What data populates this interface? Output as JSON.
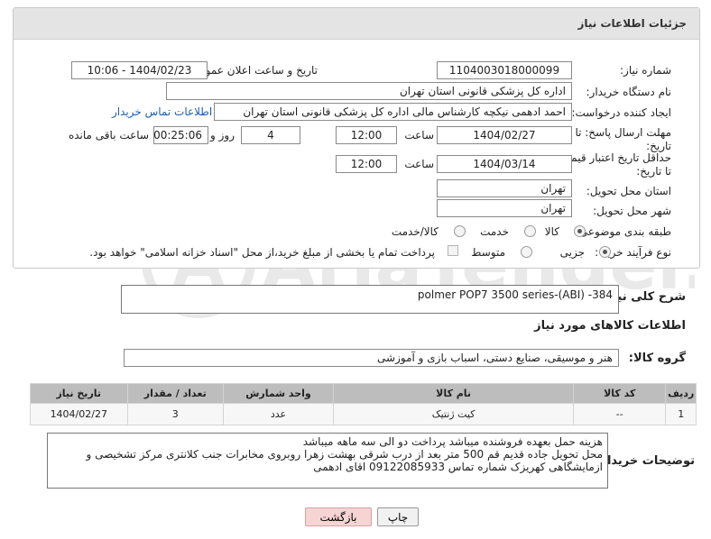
{
  "header": {
    "title": "جزئیات اطلاعات نیاز"
  },
  "fields": {
    "need_number_label": "شماره نیاز:",
    "need_number": "1104003018000099",
    "announce_label": "تاریخ و ساعت اعلان عمومی:",
    "announce_value": "1404/02/23 - 10:06",
    "buyer_org_label": "نام دستگاه خریدار:",
    "buyer_org": "اداره کل پزشکی قانونی استان تهران",
    "creator_label": "ایجاد کننده درخواست:",
    "creator": "احمد ادهمی نیکچه کارشناس مالی اداره کل پزشکی قانونی استان تهران",
    "contact_link": "اطلاعات تماس خریدار",
    "deadline_label_1": "مهلت ارسال پاسخ: تا",
    "deadline_label_2": "تاریخ:",
    "deadline_date": "1404/02/27",
    "time_label": "ساعت",
    "deadline_time": "12:00",
    "days_value": "4",
    "days_label": "روز و",
    "remaining_value": "00:25:06",
    "remaining_label": "ساعت باقی مانده",
    "validity_label_1": "حداقل تاریخ اعتبار قیمت:",
    "validity_label_2": "تا تاریخ:",
    "validity_date": "1404/03/14",
    "validity_time": "12:00",
    "province_label": "استان محل تحویل:",
    "province": "تهران",
    "city_label": "شهر محل تحویل:",
    "city": "تهران",
    "category_label": "طبقه بندی موضوعی:",
    "category_options": [
      "کالا",
      "خدمت",
      "کالا/خدمت"
    ],
    "process_label": "نوع فرآیند خرید :",
    "process_options": [
      "جزیی",
      "متوسط"
    ],
    "payment_note": "پرداخت تمام یا بخشی از مبلغ خرید،از محل \"اسناد خزانه اسلامی\" خواهد بود."
  },
  "description": {
    "label": "شرح کلی نیاز:",
    "value": "polmer POP7 3500 series-(ABI) -384"
  },
  "goods_section_title": "اطلاعات کالاهای مورد نیاز",
  "goods_group": {
    "label": "گروه کالا:",
    "value": "هنر و موسیقی، صنایع دستی، اسباب بازی و آموزشی"
  },
  "table": {
    "headers": [
      "ردیف",
      "کد کالا",
      "نام کالا",
      "واحد شمارش",
      "تعداد / مقدار",
      "تاریخ نیاز"
    ],
    "rows": [
      [
        "1",
        "--",
        "کیت ژنتیک",
        "عدد",
        "3",
        "1404/02/27"
      ]
    ]
  },
  "buyer_notes": {
    "label": "توضیحات خریدار:",
    "lines": [
      "هزینه حمل بعهده فروشنده میباشد پرداخت دو الی سه ماهه میباشد",
      "محل تحویل جاده قدیم قم 500 متر بعد از درب شرقی بهشت زهرا روبروی مخابرات جنب کلانتری مرکز تشخیصی و",
      "ازمایشگاهی کهریزک شماره تماس 09122085933 اقای ادهمی"
    ]
  },
  "buttons": {
    "print": "چاپ",
    "back": "بازگشت"
  },
  "watermark": "AriaTender.neT"
}
